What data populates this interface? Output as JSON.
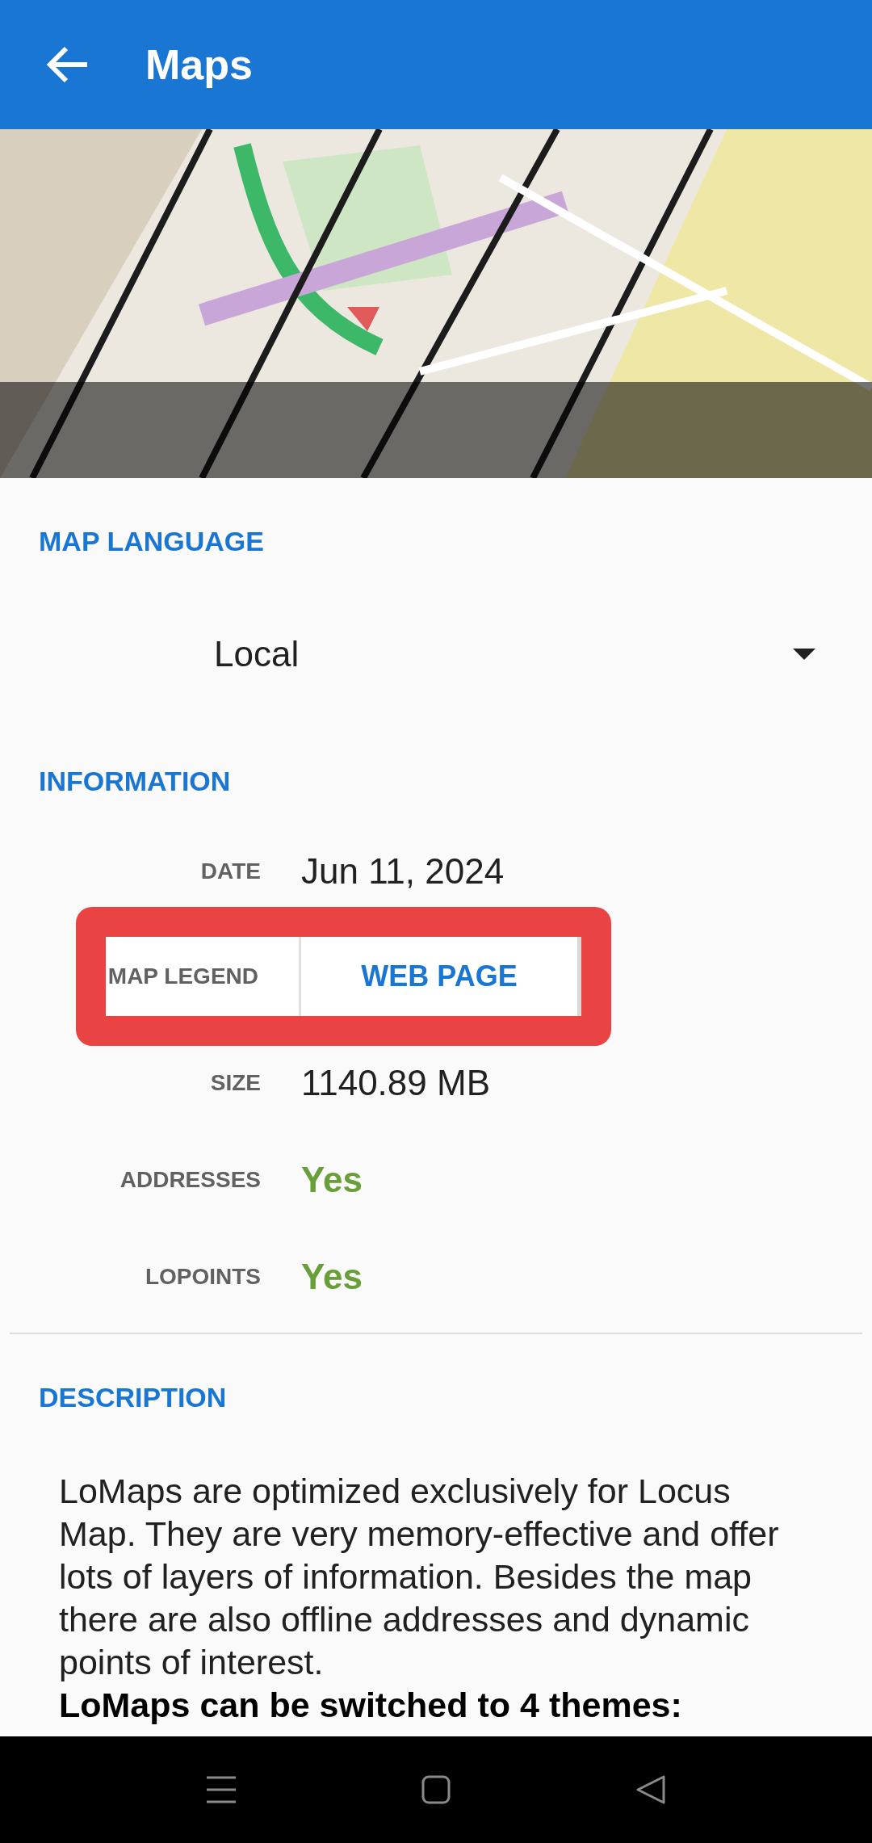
{
  "app_bar": {
    "title": "Maps"
  },
  "map_language": {
    "heading": "MAP LANGUAGE",
    "dropdown": {
      "value": "Local"
    }
  },
  "information": {
    "heading": "INFORMATION",
    "rows": [
      {
        "kind": "text",
        "label": "DATE",
        "value": "Jun 11, 2024"
      },
      {
        "kind": "button",
        "label": "MAP LEGEND",
        "value": "WEB PAGE",
        "highlighted": true
      },
      {
        "kind": "text",
        "label": "SIZE",
        "value": "1140.89 MB"
      },
      {
        "kind": "flag",
        "label": "ADDRESSES",
        "value": "Yes"
      },
      {
        "kind": "flag",
        "label": "LOPOINTS",
        "value": "Yes"
      }
    ]
  },
  "description": {
    "heading": "DESCRIPTION",
    "paragraphs": [
      {
        "kind": "normal",
        "text": "LoMaps are optimized exclusively for Locus Map. They are very memory-effective and offer lots of layers of information. Besides the map there are also offline addresses and dynamic points of interest."
      },
      {
        "kind": "bold",
        "text": "LoMaps can be switched to 4 themes:"
      }
    ]
  }
}
